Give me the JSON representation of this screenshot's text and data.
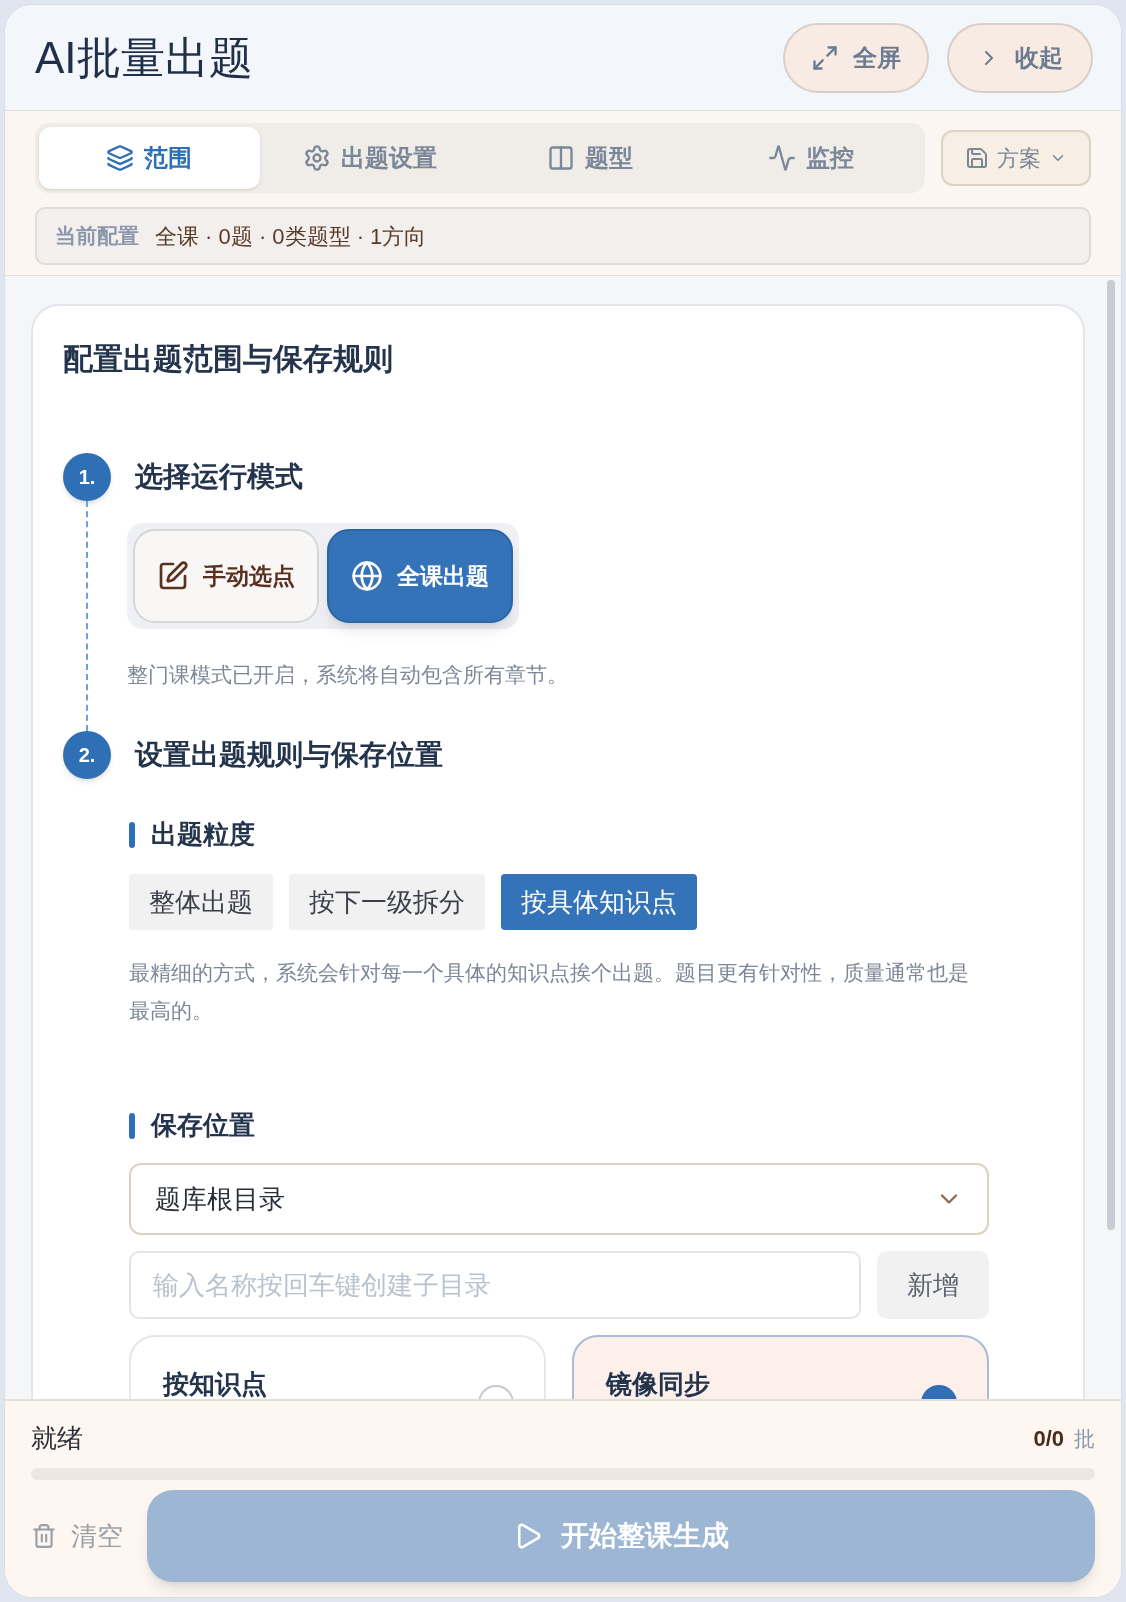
{
  "header": {
    "title": "AI批量出题",
    "buttons": [
      {
        "kind": "fullscreen",
        "label": "全屏"
      },
      {
        "kind": "collapse",
        "label": "收起"
      }
    ]
  },
  "tabs": [
    {
      "kind": "layers",
      "label": "范围",
      "selected": true
    },
    {
      "kind": "gear",
      "label": "出题设置",
      "selected": false
    },
    {
      "kind": "columns",
      "label": "题型",
      "selected": false
    },
    {
      "kind": "pulse",
      "label": "监控",
      "selected": false
    }
  ],
  "scheme_button": {
    "label": "方案"
  },
  "config_summary": {
    "label": "当前配置",
    "value": "全课 · 0题 · 0类题型 · 1方向"
  },
  "card": {
    "title": "配置出题范围与保存规则",
    "steps": [
      {
        "number": "1.",
        "title": "选择运行模式"
      },
      {
        "number": "2.",
        "title": "设置出题规则与保存位置"
      }
    ],
    "modes": [
      {
        "kind": "edit",
        "label": "手动选点",
        "selected": false
      },
      {
        "kind": "globe",
        "label": "全课出题",
        "selected": true
      }
    ],
    "mode_note": "整门课模式已开启，系统将自动包含所有章节。",
    "granularity": {
      "heading": "出题粒度",
      "options": [
        {
          "label": "整体出题",
          "selected": false
        },
        {
          "label": "按下一级拆分",
          "selected": false
        },
        {
          "label": "按具体知识点",
          "selected": true
        }
      ],
      "note": "最精细的方式，系统会针对每一个具体的知识点挨个出题。题目更有针对性，质量通常也是最高的。"
    },
    "save": {
      "heading": "保存位置",
      "select_value": "题库根目录",
      "new_folder_placeholder": "输入名称按回车键创建子目录",
      "add_button": "新增",
      "strategies": [
        {
          "label": "按知识点",
          "selected": false
        },
        {
          "label": "镜像同步",
          "selected": true
        }
      ]
    }
  },
  "footer": {
    "status": "就绪",
    "count": "0/0",
    "unit": "批",
    "level": 0,
    "clear_button": "清空",
    "start_button": "开始整课生成"
  }
}
